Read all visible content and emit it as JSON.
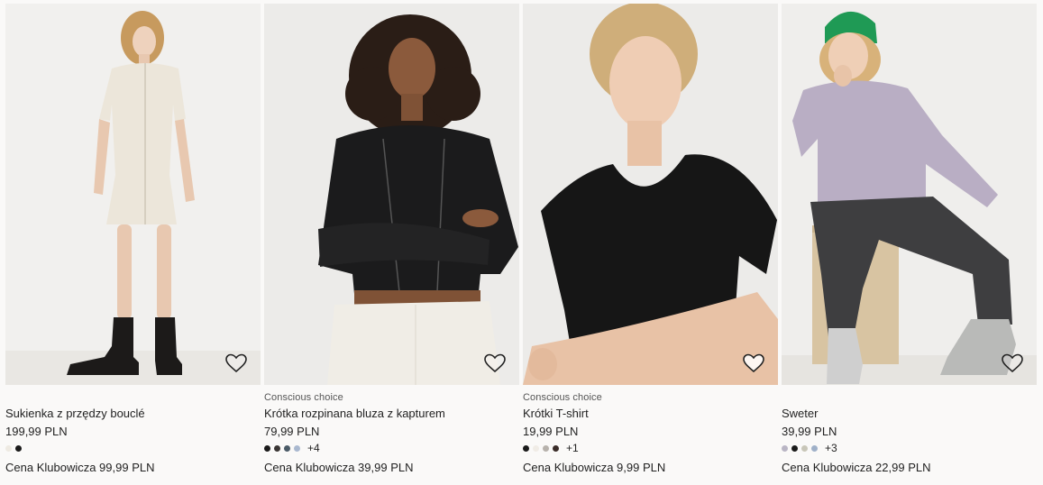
{
  "colors": {
    "background": "#faf9f8",
    "text": "#222222",
    "tag_text": "#555555"
  },
  "products": [
    {
      "tag": "",
      "name": "Sukienka z przędzy bouclé",
      "price": "199,99 PLN",
      "swatches": [
        "#eeeae2",
        "#1a1a1a"
      ],
      "more": "",
      "club_price": "Cena Klubowicza 99,99 PLN",
      "image": "model-cream-boucle-dress-icon"
    },
    {
      "tag": "Conscious choice",
      "name": "Krótka rozpinana bluza z kapturem",
      "price": "79,99 PLN",
      "swatches": [
        "#1a1a1a",
        "#3a3634",
        "#4a5a66",
        "#a9b8cf"
      ],
      "more": "+4",
      "club_price": "Cena Klubowicza 39,99 PLN",
      "image": "model-black-zip-hoodie-icon"
    },
    {
      "tag": "Conscious choice",
      "name": "Krótki T-shirt",
      "price": "19,99 PLN",
      "swatches": [
        "#1a1a1a",
        "#f0ece6",
        "#b7b2ac",
        "#3a2c28"
      ],
      "more": "+1",
      "club_price": "Cena Klubowicza 9,99 PLN",
      "image": "model-black-tshirt-icon"
    },
    {
      "tag": "",
      "name": "Sweter",
      "price": "39,99 PLN",
      "swatches": [
        "#b9b5c4",
        "#1a1a1a",
        "#c8c6b8",
        "#9fb0c8"
      ],
      "more": "+3",
      "club_price": "Cena Klubowicza 22,99 PLN",
      "image": "model-lilac-sweater-icon"
    }
  ]
}
